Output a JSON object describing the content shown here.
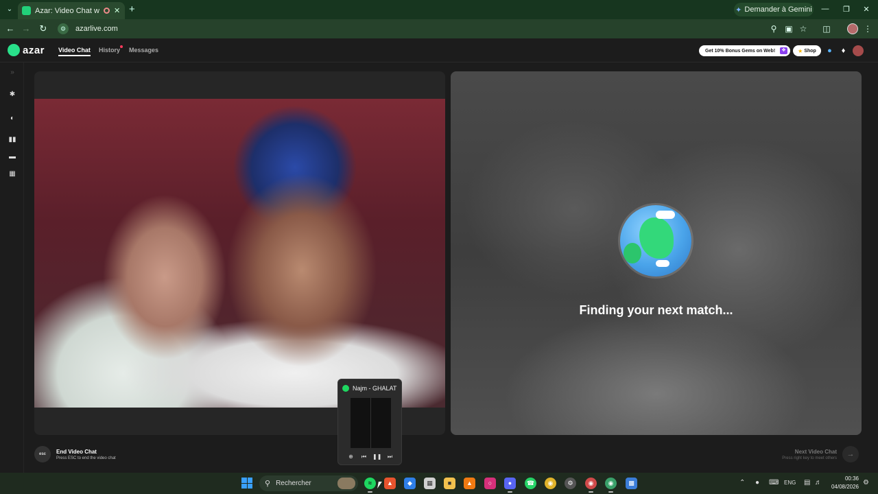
{
  "browser": {
    "tab_title": "Azar: Video Chat with New",
    "new_tab_glyph": "+",
    "gemini_label": "Demander à Gemini",
    "url": "azarlive.com",
    "icons": [
      "tab-menu-icon",
      "recording-icon",
      "close-tab-icon",
      "back-icon",
      "forward-icon",
      "reload-icon",
      "site-info-icon",
      "zoom-icon",
      "cast-icon",
      "bookmark-star-icon",
      "extensions-icon",
      "profile-avatar",
      "more-menu-icon",
      "minimize-icon",
      "maximize-icon",
      "close-window-icon"
    ]
  },
  "app": {
    "logo_text": "azar",
    "nav": {
      "video_chat": "Video Chat",
      "history": "History",
      "messages": "Messages"
    },
    "promo": "Get 10% Bonus Gems on Web!",
    "shop": "Shop",
    "header_icons": [
      "chat-bubble-icon",
      "notification-bell-icon",
      "user-avatar"
    ],
    "accent_color": "#29e08a"
  },
  "rail": {
    "icons": [
      "expand-chevron-icon",
      "magic-wand-icon",
      "filter-icon",
      "split-layout-icon",
      "stacked-layout-icon",
      "grid-layout-icon"
    ]
  },
  "remote": {
    "status_text": "Finding your next match..."
  },
  "controls": {
    "esc_badge": "esc",
    "end_title": "End Video Chat",
    "end_hint": "Press ESC to end the video chat",
    "next_title": "Next Video Chat",
    "next_hint": "Press right key to meet others"
  },
  "miniplayer": {
    "track": "Najm - GHALAT",
    "controls": [
      "add-icon",
      "previous-track-icon",
      "pause-icon",
      "next-track-icon"
    ]
  },
  "taskbar": {
    "search_label": "Rechercher",
    "language": "ENG",
    "time": "00:36",
    "date": "04/08/2026",
    "apps": [
      "spotify",
      "brave",
      "defender",
      "store",
      "file-explorer",
      "vlc",
      "instagram",
      "discord",
      "whatsapp",
      "chrome",
      "steam",
      "chrome-profile",
      "chrome-active",
      "remote-desktop"
    ]
  }
}
